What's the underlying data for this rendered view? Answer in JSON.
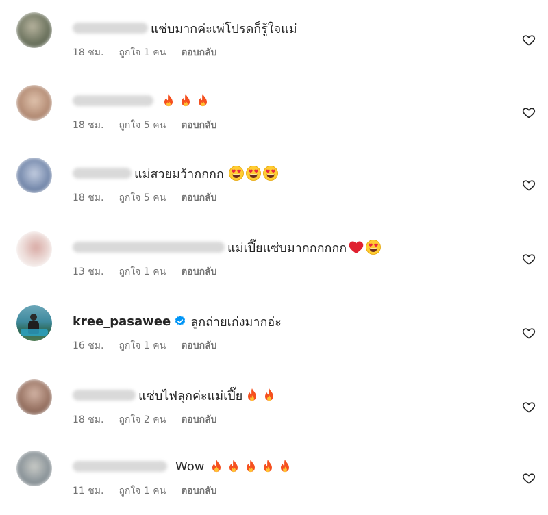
{
  "comments": [
    {
      "username": "",
      "username_blurred": true,
      "text": "แซ่บมากค่ะเพ่โปรดก็รู้ใจแม่",
      "emojis": [],
      "time": "18 ชม.",
      "likes": "ถูกใจ 1 คน",
      "reply": "ตอบกลับ",
      "avatar_color": "#8a8f7c"
    },
    {
      "username": "",
      "username_blurred": true,
      "text": "",
      "emojis": [
        "fire-emoji",
        "fire-emoji",
        "fire-emoji"
      ],
      "time": "18 ชม.",
      "likes": "ถูกใจ 5 คน",
      "reply": "ตอบกลับ",
      "avatar_color": "#c4a48e"
    },
    {
      "username": "",
      "username_blurred": true,
      "text": "แม่สวยมว้ากกกก",
      "emojis": [
        "heart-eyes-emoji",
        "heart-eyes-emoji",
        "heart-eyes-emoji"
      ],
      "time": "18 ชม.",
      "likes": "ถูกใจ 5 คน",
      "reply": "ตอบกลับ",
      "avatar_color": "#7b8fae"
    },
    {
      "username": "",
      "username_blurred": true,
      "text": "แม่เปี๊ยแซ่บมากกกกกก",
      "emojis": [
        "red-heart-emoji",
        "heart-eyes-emoji"
      ],
      "time": "13 ชม.",
      "likes": "ถูกใจ 1 คน",
      "reply": "ตอบกลับ",
      "avatar_color": "#e8d7d3"
    },
    {
      "username": "kree_pasawee",
      "username_blurred": false,
      "verified": true,
      "text": "ลูกถ่ายเก่งมากอ่ะ",
      "emojis": [],
      "time": "16 ชม.",
      "likes": "ถูกใจ 1 คน",
      "reply": "ตอบกลับ",
      "avatar_color": "#4f7d6a"
    },
    {
      "username": "",
      "username_blurred": true,
      "text": "แซ่บไฟลุกค่ะแม่เปี๊ย",
      "emojis": [
        "fire-emoji",
        "fire-emoji"
      ],
      "time": "18 ชม.",
      "likes": "ถูกใจ 2 คน",
      "reply": "ตอบกลับ",
      "avatar_color": "#a6887a"
    },
    {
      "username": "",
      "username_blurred": true,
      "text": "Wow",
      "emojis": [
        "fire-emoji",
        "fire-emoji",
        "fire-emoji",
        "fire-emoji",
        "fire-emoji"
      ],
      "time": "11 ชม.",
      "likes": "ถูกใจ 1 คน",
      "reply": "ตอบกลับ",
      "avatar_color": "#9aa3a8"
    }
  ]
}
